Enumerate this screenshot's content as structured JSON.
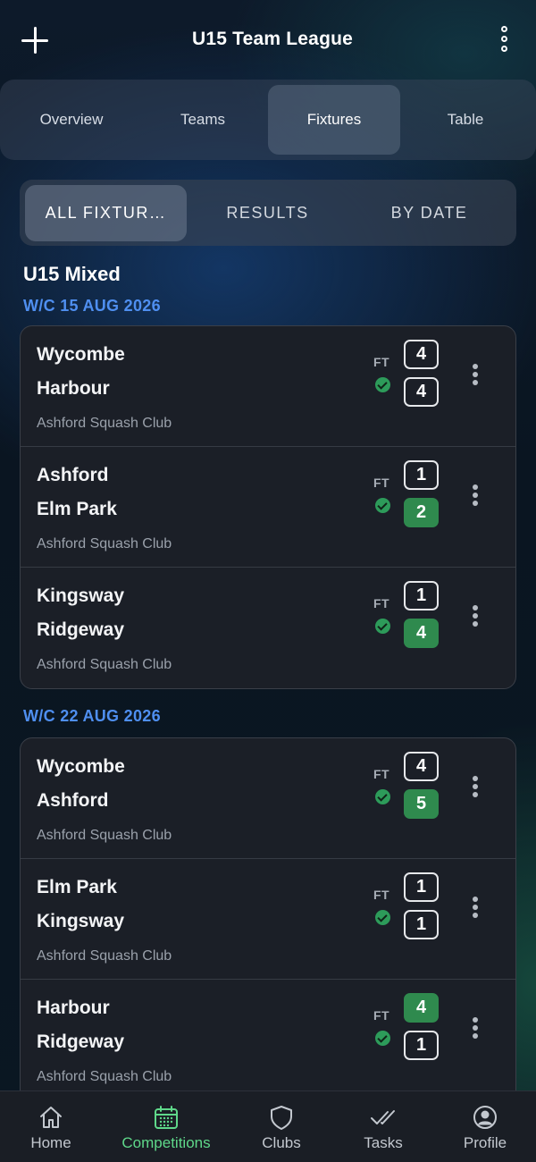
{
  "header": {
    "title": "U15 Team League",
    "add_icon": "plus-icon",
    "menu_icon": "more-vertical-icon"
  },
  "tabs": [
    {
      "label": "Overview",
      "active": false
    },
    {
      "label": "Teams",
      "active": false
    },
    {
      "label": "Fixtures",
      "active": true
    },
    {
      "label": "Table",
      "active": false
    }
  ],
  "filters": [
    {
      "label": "ALL FIXTUR…",
      "active": true
    },
    {
      "label": "RESULTS",
      "active": false
    },
    {
      "label": "BY DATE",
      "active": false
    }
  ],
  "division": "U15 Mixed",
  "weeks": [
    {
      "label": "W/C 15 AUG 2026",
      "fixtures": [
        {
          "home": "Wycombe",
          "away": "Harbour",
          "venue": "Ashford Squash Club",
          "status": "FT",
          "home_score": "4",
          "away_score": "4",
          "winner": "none"
        },
        {
          "home": "Ashford",
          "away": "Elm Park",
          "venue": "Ashford Squash Club",
          "status": "FT",
          "home_score": "1",
          "away_score": "2",
          "winner": "away"
        },
        {
          "home": "Kingsway",
          "away": "Ridgeway",
          "venue": "Ashford Squash Club",
          "status": "FT",
          "home_score": "1",
          "away_score": "4",
          "winner": "away"
        }
      ]
    },
    {
      "label": "W/C 22 AUG 2026",
      "fixtures": [
        {
          "home": "Wycombe",
          "away": "Ashford",
          "venue": "Ashford Squash Club",
          "status": "FT",
          "home_score": "4",
          "away_score": "5",
          "winner": "away"
        },
        {
          "home": "Elm Park",
          "away": "Kingsway",
          "venue": "Ashford Squash Club",
          "status": "FT",
          "home_score": "1",
          "away_score": "1",
          "winner": "none"
        },
        {
          "home": "Harbour",
          "away": "Ridgeway",
          "venue": "Ashford Squash Club",
          "status": "FT",
          "home_score": "4",
          "away_score": "1",
          "winner": "home"
        }
      ]
    }
  ],
  "bottom_nav": [
    {
      "label": "Home",
      "icon": "home-icon",
      "active": false
    },
    {
      "label": "Competitions",
      "icon": "calendar-icon",
      "active": true
    },
    {
      "label": "Clubs",
      "icon": "shield-icon",
      "active": false
    },
    {
      "label": "Tasks",
      "icon": "double-check-icon",
      "active": false
    },
    {
      "label": "Profile",
      "icon": "user-circle-icon",
      "active": false
    }
  ],
  "colors": {
    "accent_blue": "#4f8ff0",
    "win_green": "#2f8a4e",
    "active_nav_green": "#5fd88a",
    "card_bg": "#1b1f27"
  }
}
